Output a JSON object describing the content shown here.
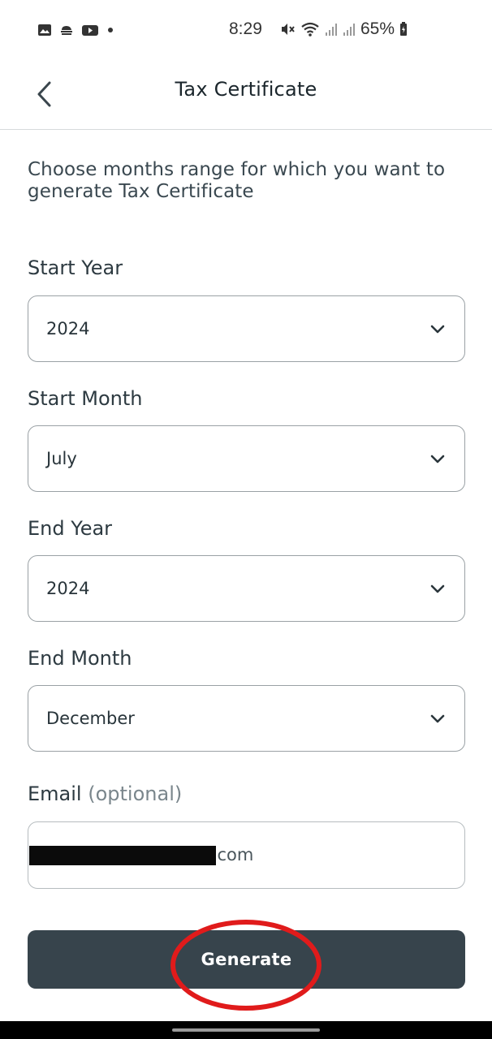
{
  "status_bar": {
    "time": "8:29",
    "battery": "65%",
    "icons": [
      "gallery-icon",
      "weather-icon",
      "youtube-icon",
      "dot-icon",
      "mute-icon",
      "wifi-icon",
      "signal-icon",
      "signal-icon",
      "battery-icon"
    ]
  },
  "header": {
    "title": "Tax Certificate",
    "back_icon": "chevron-left-icon"
  },
  "form": {
    "intro": "Choose months range for which you want to generate Tax Certificate",
    "start_year": {
      "label": "Start Year",
      "value": "2024"
    },
    "start_month": {
      "label": "Start Month",
      "value": "July"
    },
    "end_year": {
      "label": "End Year",
      "value": "2024"
    },
    "end_month": {
      "label": "End Month",
      "value": "December"
    },
    "email": {
      "label": "Email",
      "label_suffix": "(optional)",
      "value": "mesh.reaha@gmail.com"
    }
  },
  "actions": {
    "generate_label": "Generate"
  },
  "colors": {
    "button_bg": "#37444c",
    "annotation": "#e01b1b"
  }
}
